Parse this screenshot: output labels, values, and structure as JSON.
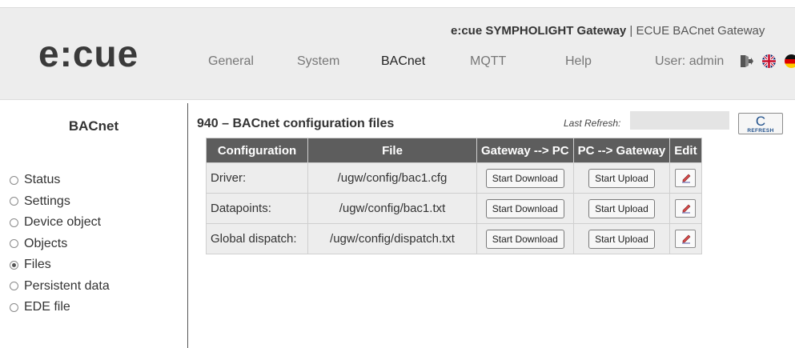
{
  "header": {
    "logo": "e:cue",
    "product_bold": "e:cue SYMPHOLIGHT Gateway",
    "product_rest": " | ECUE BACnet Gateway",
    "nav": [
      "General",
      "System",
      "BACnet",
      "MQTT",
      "Help"
    ],
    "active_nav": "BACnet",
    "user_label": "User:",
    "user_name": "admin",
    "icons": [
      "logout-icon",
      "flag-uk-icon",
      "flag-de-icon"
    ]
  },
  "sidebar": {
    "title": "BACnet",
    "items": [
      {
        "label": "Status",
        "checked": false
      },
      {
        "label": "Settings",
        "checked": false
      },
      {
        "label": "Device object",
        "checked": false
      },
      {
        "label": "Objects",
        "checked": false
      },
      {
        "label": "Files",
        "checked": true
      },
      {
        "label": "Persistent data",
        "checked": false
      },
      {
        "label": "EDE file",
        "checked": false
      }
    ]
  },
  "main": {
    "title": "940 – BACnet configuration files",
    "last_refresh_label": "Last Refresh:",
    "refresh_button": {
      "symbol": "C",
      "label": "REFRESH"
    },
    "table": {
      "headers": [
        "Configuration",
        "File",
        "Gateway --> PC",
        "PC --> Gateway",
        "Edit"
      ],
      "rows": [
        {
          "config": "Driver:",
          "file": "/ugw/config/bac1.cfg",
          "download": "Start Download",
          "upload": "Start Upload"
        },
        {
          "config": "Datapoints:",
          "file": "/ugw/config/bac1.txt",
          "download": "Start Download",
          "upload": "Start Upload"
        },
        {
          "config": "Global dispatch:",
          "file": "/ugw/config/dispatch.txt",
          "download": "Start Download",
          "upload": "Start Upload"
        }
      ]
    }
  },
  "colors": {
    "header_bg": "#ededed",
    "table_header_bg": "#5d5d5d",
    "table_cell_bg": "#ededed",
    "accent_blue": "#1f4f8a"
  }
}
